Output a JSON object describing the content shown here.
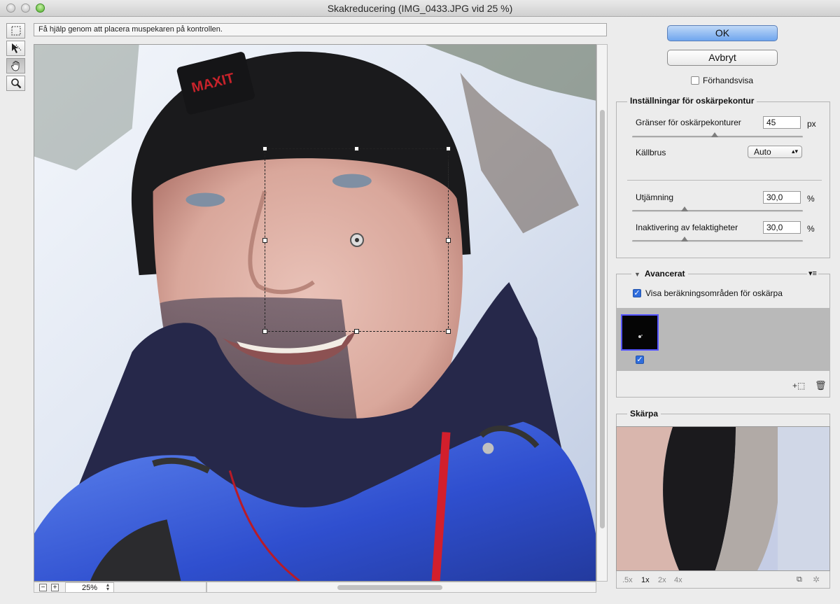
{
  "window": {
    "title": "Skakreducering (IMG_0433.JPG vid 25 %)"
  },
  "tools": [
    {
      "name": "marquee-tool"
    },
    {
      "name": "blur-direction-tool"
    },
    {
      "name": "hand-tool"
    },
    {
      "name": "zoom-tool"
    }
  ],
  "help": {
    "text": "Få hjälp genom att placera muspekaren på kontrollen."
  },
  "canvas": {
    "zoom_value": "25%"
  },
  "buttons": {
    "ok": "OK",
    "cancel": "Avbryt"
  },
  "preview_toggle": {
    "label": "Förhandsvisa",
    "checked": false
  },
  "blur_settings": {
    "title": "Inställningar för oskärpekontur",
    "bounds_label": "Gränser för oskärpekonturer",
    "bounds_value": "45",
    "bounds_unit": "px",
    "source_noise_label": "Källbrus",
    "source_noise_value": "Auto",
    "smoothing_label": "Utjämning",
    "smoothing_value": "30,0",
    "smoothing_unit": "%",
    "artifact_label": "Inaktivering av felaktigheter",
    "artifact_value": "30,0",
    "artifact_unit": "%"
  },
  "advanced": {
    "title": "Avancerat",
    "show_regions_label": "Visa beräkningsområden för oskärpa",
    "show_regions_checked": true
  },
  "detail": {
    "title": "Skärpa",
    "zoom_levels": [
      ".5x",
      "1x",
      "2x",
      "4x"
    ],
    "active_zoom": "1x"
  }
}
